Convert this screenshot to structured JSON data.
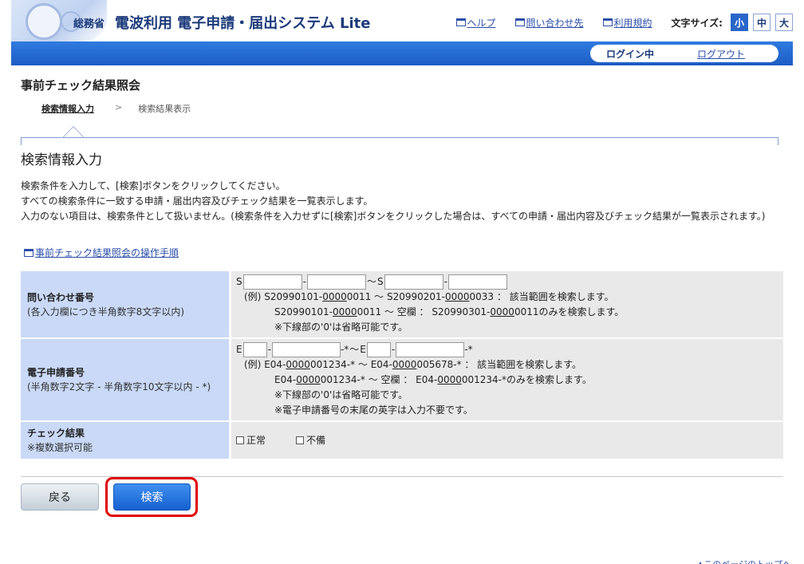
{
  "header": {
    "ministry": "総務省",
    "system_title": "電波利用 電子申請・届出システム Lite",
    "links": {
      "help": "ヘルプ",
      "contact": "問い合わせ先",
      "terms": "利用規約"
    },
    "font_size_label": "文字サイズ:",
    "font_sizes": [
      "小",
      "中",
      "大"
    ],
    "font_size_active": "小"
  },
  "blue_bar": {
    "login_status": "ログイン中",
    "logout": "ログアウト"
  },
  "page": {
    "title": "事前チェック結果照会",
    "steps": {
      "current": "検索情報入力",
      "separator": ">",
      "next": "検索結果表示"
    },
    "section_title": "検索情報入力",
    "description": [
      "検索条件を入力して、[検索]ボタンをクリックしてください。",
      "すべての検索条件に一致する申請・届出内容及びチェック結果を一覧表示します。",
      "入力のない項目は、検索条件として扱いません。(検索条件を入力せずに[検索]ボタンをクリックした場合は、すべての申請・届出内容及びチェック結果が一覧表示されます。)"
    ],
    "guide_link": "事前チェック結果照会の操作手順"
  },
  "form": {
    "inquiry": {
      "label": "問い合わせ番号",
      "sub": "(各入力欄につき半角数字8文字以内)",
      "prefix": "S",
      "range_sep": "～",
      "dash": "-",
      "example_1_prefix": "(例)",
      "example_1a": "S20990101-",
      "example_1b": "0000",
      "example_1c": "0011 ～ S20990201-",
      "example_1d": "0000",
      "example_1e": "0033 ： 該当範囲を検索します。",
      "example_2a": "S20990101-",
      "example_2b": "0000",
      "example_2c": "0011 ～ 空欄 ： S20990301-",
      "example_2d": "0000",
      "example_2e": "0011のみを検索します。",
      "note": "※下線部の'0'は省略可能です。"
    },
    "eapp": {
      "label": "電子申請番号",
      "sub": "(半角数字2文字 - 半角数字10文字以内 - *)",
      "prefix": "E",
      "suffix": "-*",
      "range_sep": "～",
      "dash": "-",
      "example_1_prefix": "(例)",
      "example_1a": "E04-",
      "example_1b": "0000",
      "example_1c": "001234-* ～ E04-",
      "example_1d": "0000",
      "example_1e": "005678-* ： 該当範囲を検索します。",
      "example_2a": "E04-",
      "example_2b": "0000",
      "example_2c": "001234-* ～ 空欄 ： E04-",
      "example_2d": "0000",
      "example_2e": "001234-*のみを検索します。",
      "note_1": "※下線部の'0'は省略可能です。",
      "note_2": "※電子申請番号の末尾の英字は入力不要です。"
    },
    "check": {
      "label": "チェック結果",
      "sub": "※複数選択可能",
      "options": [
        "正常",
        "不備"
      ]
    }
  },
  "buttons": {
    "back": "戻る",
    "search": "検索"
  },
  "footer": {
    "page_top": "▲このページのトップへ"
  }
}
